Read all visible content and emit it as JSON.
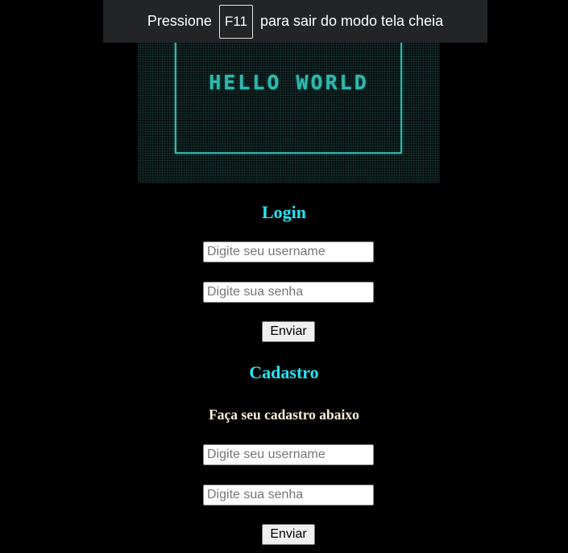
{
  "banner": {
    "text": "HELLO WORLD",
    "accent_color": "#2fb8ae"
  },
  "fullscreen_toast": {
    "prefix": "Pressione",
    "key": "F11",
    "suffix": "para sair do modo tela cheia"
  },
  "login": {
    "title": "Login",
    "username_placeholder": "Digite seu username",
    "password_placeholder": "Digite sua senha",
    "submit_label": "Enviar"
  },
  "cadastro": {
    "title": "Cadastro",
    "subtitle": "Faça seu cadastro abaixo",
    "username_placeholder": "Digite seu username",
    "password_placeholder": "Digite sua senha",
    "submit_label": "Enviar"
  },
  "colors": {
    "background": "#000000",
    "heading": "#22e5f2",
    "subheading": "#fbefd6"
  }
}
